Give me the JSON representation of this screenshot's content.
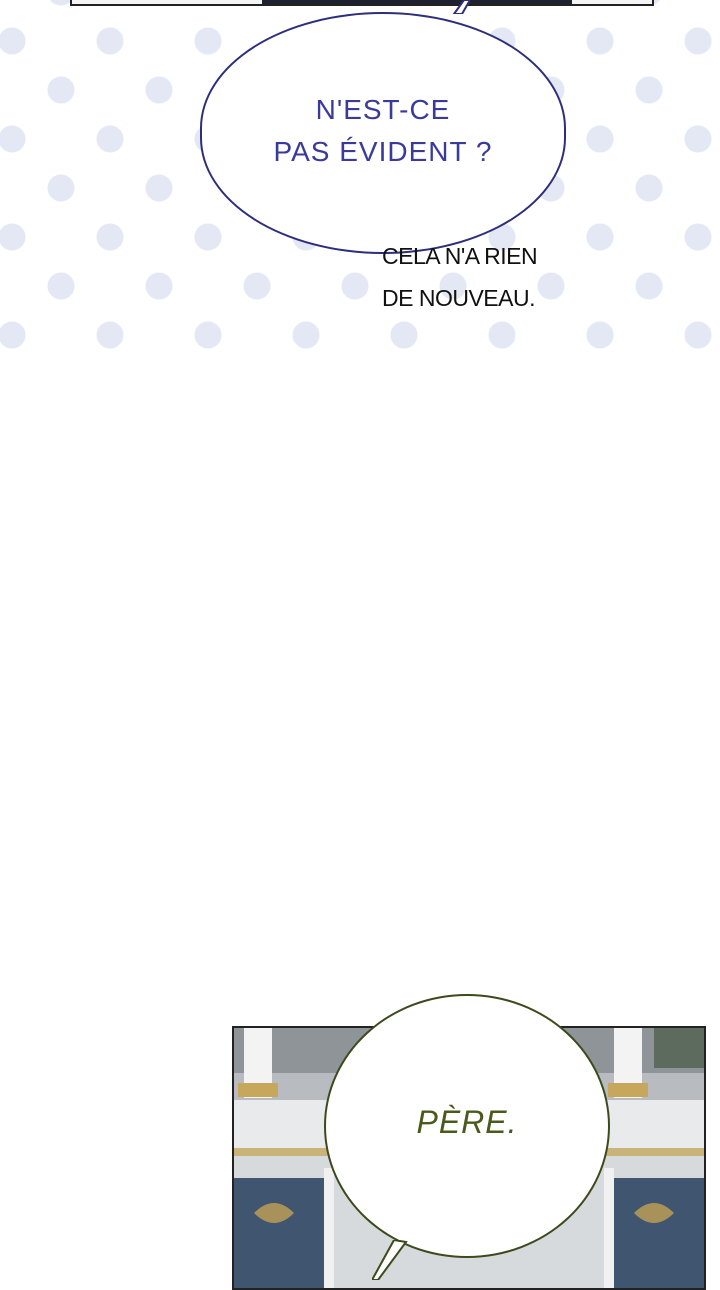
{
  "panels": [
    {
      "speech_bubble": "N'EST-CE\nPAS ÉVIDENT ?",
      "narration": "CELA N'A RIEN\nDE NOUVEAU."
    },
    {
      "speech_bubble": "PÈRE."
    }
  ],
  "colors": {
    "dot_pattern": "#e3e8f4",
    "blue_bubble_outline": "#2d2f7a",
    "blue_bubble_text": "#3a3a9a",
    "green_bubble_outline": "#3d4a1e",
    "green_bubble_text": "#4a5a1c",
    "panel_wall": "#3f5570"
  }
}
